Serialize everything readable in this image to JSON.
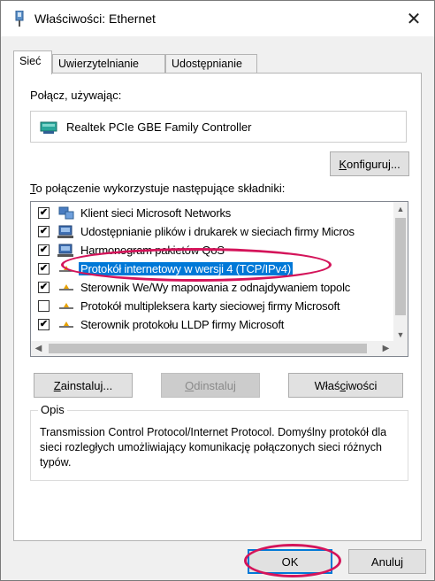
{
  "window": {
    "title": "Właściwości: Ethernet",
    "close_glyph": "✕"
  },
  "tabs": [
    {
      "label": "Sieć",
      "active": true
    },
    {
      "label": "Uwierzytelnianie",
      "active": false
    },
    {
      "label": "Udostępnianie",
      "active": false
    }
  ],
  "connect_using": {
    "label": "Połącz, używając:",
    "adapter_name": "Realtek PCIe GBE Family Controller"
  },
  "configure_button": {
    "label_pre": "",
    "label_u": "K",
    "label_post": "onfiguruj..."
  },
  "components": {
    "label_u": "T",
    "label_rest": "o połączenie wykorzystuje następujące składniki:",
    "items": [
      {
        "label": "Klient sieci Microsoft Networks",
        "checked": true,
        "icon": "network-client-icon"
      },
      {
        "label": "Udostępnianie plików i drukarek w sieciach firmy Micros",
        "checked": true,
        "icon": "file-printer-sharing-icon"
      },
      {
        "label": "Harmonogram pakietów QoS",
        "checked": true,
        "icon": "qos-scheduler-icon"
      },
      {
        "label": "Protokół internetowy w wersji 4 (TCP/IPv4)",
        "checked": true,
        "icon": "protocol-icon",
        "selected": true
      },
      {
        "label": "Sterownik We/Wy mapowania z odnajdywaniem topolc",
        "checked": true,
        "icon": "protocol-icon"
      },
      {
        "label": "Protokół multipleksera karty sieciowej firmy Microsoft",
        "checked": false,
        "icon": "protocol-icon"
      },
      {
        "label": "Sterownik protokołu LLDP firmy Microsoft",
        "checked": true,
        "icon": "protocol-icon"
      }
    ]
  },
  "action_buttons": {
    "install": {
      "label_u": "Z",
      "label_rest": "ainstaluj..."
    },
    "uninstall": {
      "label_u": "O",
      "label_rest": "dinstaluj"
    },
    "properties": {
      "label_pre": "Właś",
      "label_u": "c",
      "label_post": "iwości"
    }
  },
  "description": {
    "legend": "Opis",
    "text": "Transmission Control Protocol/Internet Protocol. Domyślny protokół dla sieci rozległych umożliwiający komunikację połączonych sieci różnych typów."
  },
  "footer": {
    "ok_label": "OK",
    "cancel_label": "Anuluj"
  },
  "colors": {
    "accent": "#0078d7",
    "annotation": "#d4145a"
  }
}
